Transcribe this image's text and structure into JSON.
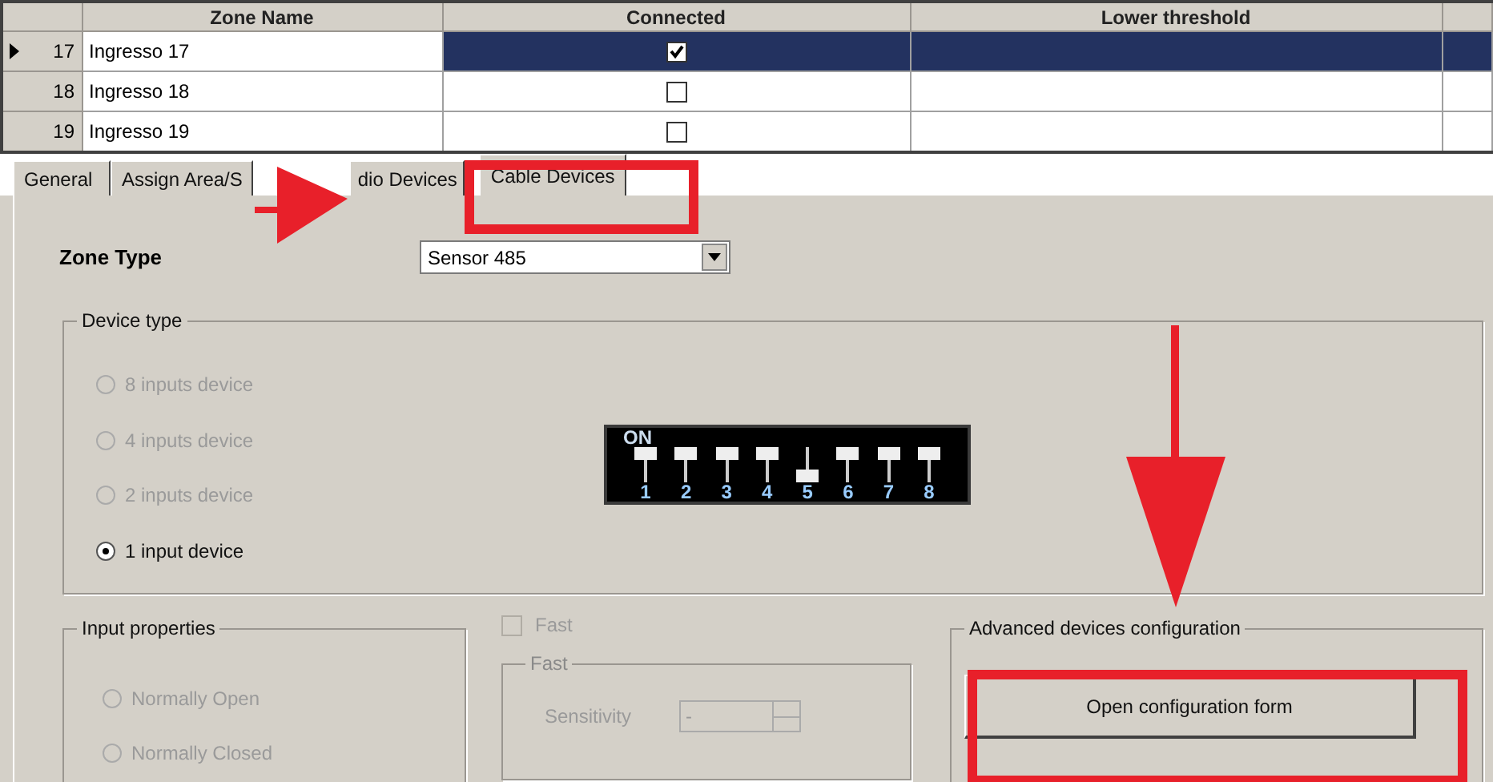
{
  "grid": {
    "columns": [
      "Zone Name",
      "Connected",
      "Lower threshold"
    ],
    "rows": [
      {
        "number": "17",
        "name": "Ingresso 17",
        "connected": true,
        "selected": true
      },
      {
        "number": "18",
        "name": "Ingresso 18",
        "connected": false,
        "selected": false
      },
      {
        "number": "19",
        "name": "Ingresso 19",
        "connected": false,
        "selected": false
      }
    ]
  },
  "tabs": [
    {
      "label": "General",
      "selected": false
    },
    {
      "label": "Assign Area/S",
      "selected": false
    },
    {
      "label": "dio Devices",
      "selected": false
    },
    {
      "label": "Cable Devices",
      "selected": true
    }
  ],
  "zone_type": {
    "label": "Zone Type",
    "value": "Sensor 485"
  },
  "device_type": {
    "title": "Device type",
    "options": [
      {
        "label": "8 inputs device",
        "selected": false,
        "disabled": true
      },
      {
        "label": "4 inputs device",
        "selected": false,
        "disabled": true
      },
      {
        "label": "2 inputs device",
        "selected": false,
        "disabled": true
      },
      {
        "label": "1 input device",
        "selected": true,
        "disabled": false
      }
    ],
    "dip_switch": {
      "label": "ON",
      "switches": [
        {
          "label": "1",
          "on": true
        },
        {
          "label": "2",
          "on": true
        },
        {
          "label": "3",
          "on": true
        },
        {
          "label": "4",
          "on": true
        },
        {
          "label": "5",
          "on": false
        },
        {
          "label": "6",
          "on": true
        },
        {
          "label": "7",
          "on": true
        },
        {
          "label": "8",
          "on": true
        }
      ]
    }
  },
  "input_properties": {
    "title": "Input properties",
    "options": [
      {
        "label": "Normally Open",
        "selected": false,
        "disabled": true
      },
      {
        "label": "Normally Closed",
        "selected": false,
        "disabled": true
      }
    ]
  },
  "fast_checkbox": {
    "label": "Fast",
    "checked": false,
    "disabled": true
  },
  "fast_group": {
    "title": "Fast",
    "sensitivity": {
      "label": "Sensitivity",
      "value": "-",
      "disabled": true
    }
  },
  "advanced": {
    "title": "Advanced devices configuration",
    "button": "Open configuration form"
  }
}
